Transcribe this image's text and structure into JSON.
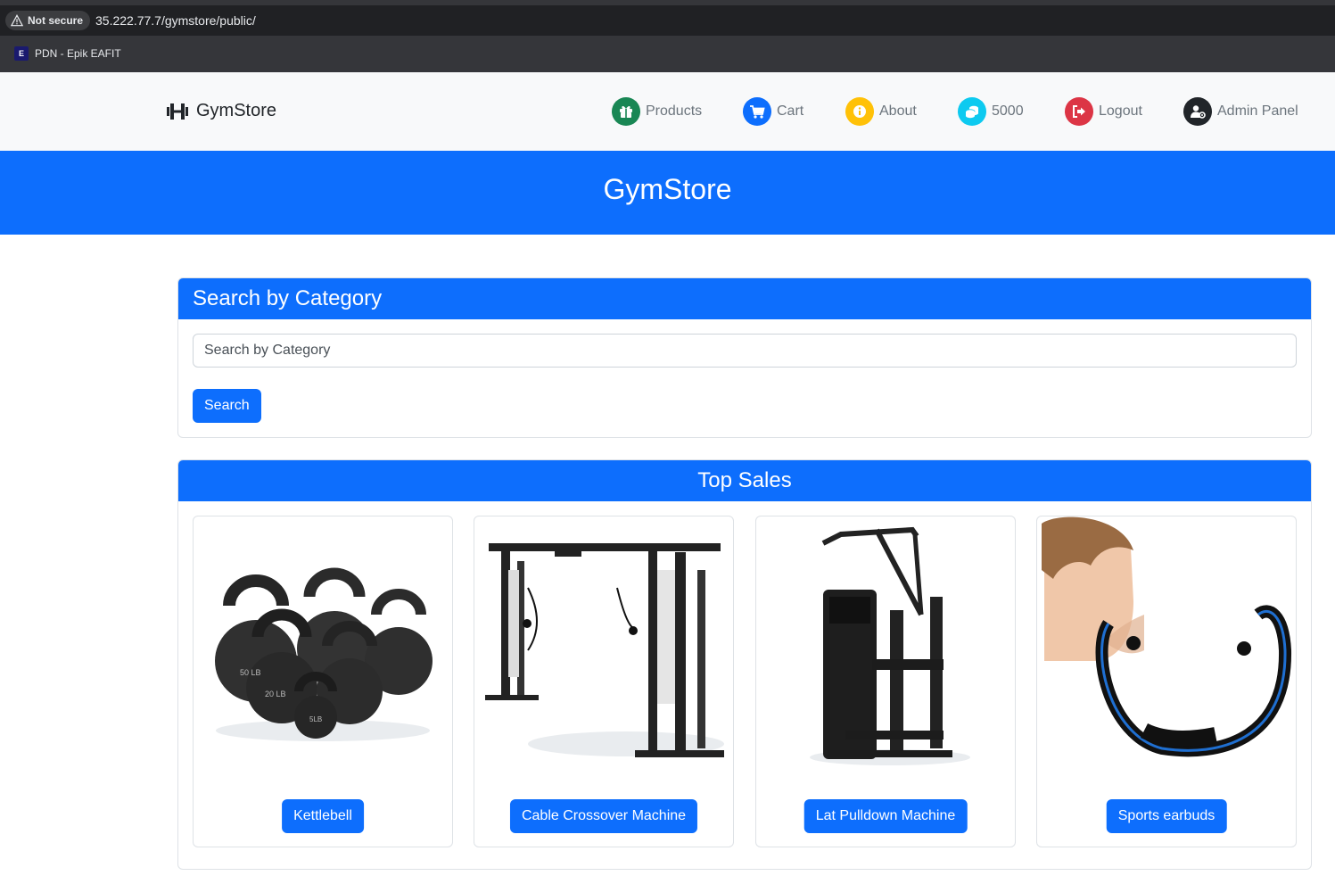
{
  "browser": {
    "security_label": "Not secure",
    "url": "35.222.77.7/gymstore/public/",
    "bookmark_label": "PDN - Epik EAFIT",
    "bookmark_favicon_letter": "E"
  },
  "navbar": {
    "brand": "GymStore",
    "items": [
      {
        "label": "Products",
        "icon": "gift-icon",
        "color": "#198754"
      },
      {
        "label": "Cart",
        "icon": "cart-icon",
        "color": "#0d6efd"
      },
      {
        "label": "About",
        "icon": "info-icon",
        "color": "#ffc107"
      },
      {
        "label": "5000",
        "icon": "coins-icon",
        "color": "#0dcaf0"
      },
      {
        "label": "Logout",
        "icon": "logout-icon",
        "color": "#dc3545"
      },
      {
        "label": "Admin Panel",
        "icon": "user-gear-icon",
        "color": "#212529"
      }
    ]
  },
  "hero": {
    "title": "GymStore"
  },
  "search": {
    "header": "Search by Category",
    "placeholder": "Search by Category",
    "button": "Search"
  },
  "top_sales": {
    "header": "Top Sales",
    "products": [
      {
        "name": "Kettlebell",
        "image": "kettlebell-image"
      },
      {
        "name": "Cable Crossover Machine",
        "image": "cable-crossover-image"
      },
      {
        "name": "Lat Pulldown Machine",
        "image": "lat-pulldown-image"
      },
      {
        "name": "Sports earbuds",
        "image": "earbuds-image"
      }
    ]
  },
  "colors": {
    "primary": "#0d6efd",
    "navbar_bg": "#f8f9fa"
  }
}
